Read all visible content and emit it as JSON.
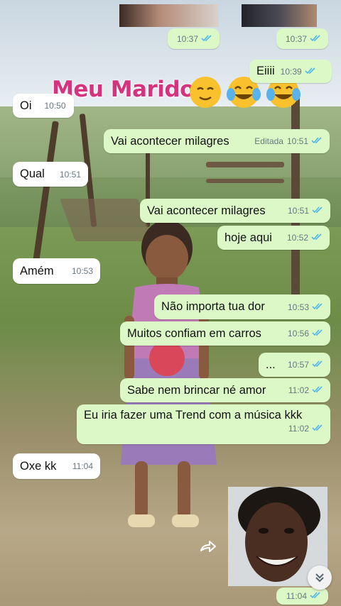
{
  "overlay": {
    "title": "Meu Marido",
    "emojis": [
      "relieved-face",
      "tears-of-joy-face",
      "tears-of-joy-face"
    ]
  },
  "colors": {
    "outgoing_bubble": "#dcf8c6",
    "incoming_bubble": "#ffffff",
    "read_ticks": "#4fb6ec",
    "title_pink": "#d6337f"
  },
  "messages": [
    {
      "text": "",
      "time": "10:37",
      "dir": "out",
      "read": true
    },
    {
      "text": "",
      "time": "10:37",
      "dir": "out",
      "read": true
    },
    {
      "text": "Eiiii",
      "time": "10:39",
      "dir": "out",
      "read": true
    },
    {
      "text": "Oi",
      "time": "10:50",
      "dir": "in"
    },
    {
      "text": "Vai acontecer milagres",
      "edited_label": "Editada",
      "time": "10:51",
      "dir": "out",
      "read": true
    },
    {
      "text": "Qual",
      "time": "10:51",
      "dir": "in"
    },
    {
      "text": "Vai acontecer milagres",
      "time": "10:51",
      "dir": "out",
      "read": true
    },
    {
      "text": "hoje aqui",
      "time": "10:52",
      "dir": "out",
      "read": true
    },
    {
      "text": "Amém",
      "time": "10:53",
      "dir": "in"
    },
    {
      "text": "Não importa tua dor",
      "time": "10:53",
      "dir": "out",
      "read": true
    },
    {
      "text": "Muitos confiam em carros",
      "time": "10:56",
      "dir": "out",
      "read": true
    },
    {
      "text": "...",
      "time": "10:57",
      "dir": "out",
      "read": true
    },
    {
      "text": "Sabe nem brincar né amor",
      "time": "11:02",
      "dir": "out",
      "read": true
    },
    {
      "text": "Eu iria fazer uma Trend com a música kkk",
      "time": "11:02",
      "dir": "out",
      "read": true
    },
    {
      "text": "Oxe kk",
      "time": "11:04",
      "dir": "in"
    },
    {
      "text": "",
      "time": "11:04",
      "dir": "out",
      "read": true
    }
  ],
  "icons": {
    "forward": "forward-arrow-icon",
    "scroll_down": "double-chevron-down-icon",
    "read_receipt": "double-check-icon"
  }
}
